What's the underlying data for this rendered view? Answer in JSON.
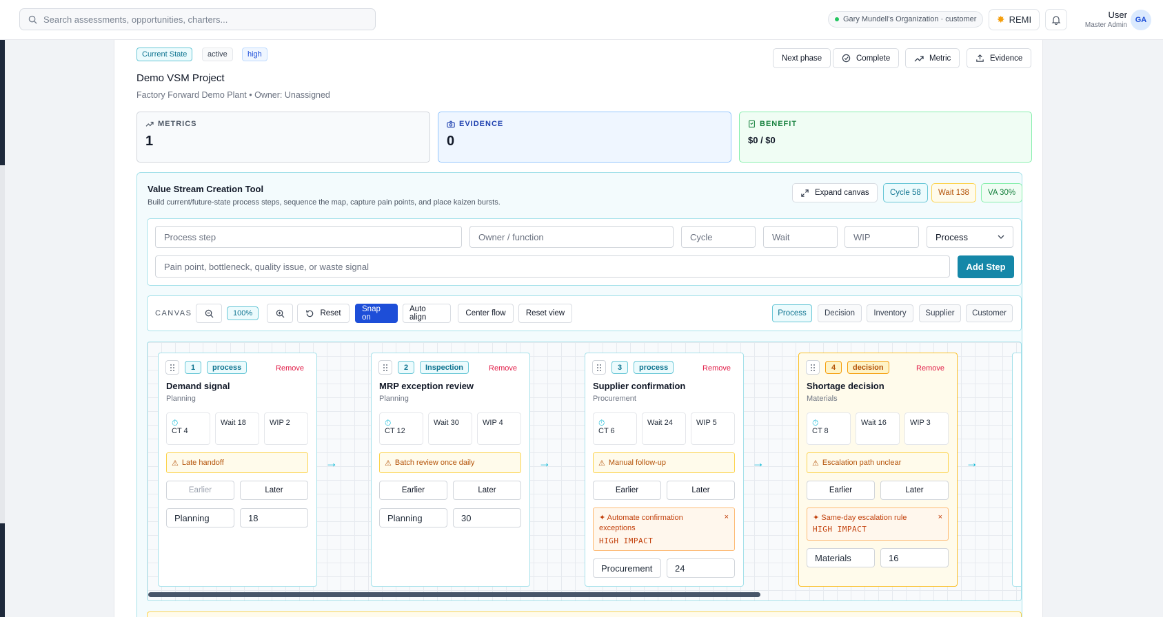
{
  "topbar": {
    "search_placeholder": "Search assessments, opportunities, charters...",
    "org": "Gary Mundell's Organization · customer",
    "remi": "REMI",
    "user_name": "User",
    "user_role": "Master Admin",
    "avatar": "GA"
  },
  "project": {
    "chips": [
      "Current State",
      "active",
      "high"
    ],
    "actions": [
      "Next phase",
      "Complete",
      "Metric",
      "Evidence"
    ],
    "title": "Demo VSM Project",
    "subtitle": "Factory Forward Demo Plant • Owner: Unassigned"
  },
  "cards": {
    "metrics_label": "METRICS",
    "metrics_value": "1",
    "evidence_label": "EVIDENCE",
    "evidence_value": "0",
    "benefit_label": "BENEFIT",
    "benefit_value": "$0 / $0"
  },
  "tool": {
    "title": "Value Stream Creation Tool",
    "desc": "Build current/future-state process steps, sequence the map, capture pain points, and place kaizen bursts.",
    "expand": "Expand canvas",
    "cycle": "Cycle 58",
    "wait": "Wait 138",
    "va": "VA 30%"
  },
  "form": {
    "step_ph": "Process step",
    "owner_ph": "Owner / function",
    "cycle_ph": "Cycle",
    "wait_ph": "Wait",
    "wip_ph": "WIP",
    "type_value": "Process",
    "pain_ph": "Pain point, bottleneck, quality issue, or waste signal",
    "add": "Add Step"
  },
  "canvas": {
    "label": "CANVAS",
    "zoom": "100%",
    "reset": "Reset",
    "snap": "Snap on",
    "auto_align": "Auto align",
    "center": "Center flow",
    "reset_view": "Reset view",
    "types": [
      "Process",
      "Decision",
      "Inventory",
      "Supplier",
      "Customer"
    ]
  },
  "steps": [
    {
      "n": "1",
      "kind": "process",
      "name": "Demand signal",
      "func": "Planning",
      "ct": "CT 4",
      "wait": "Wait 18",
      "wip": "WIP 2",
      "pain": "Late handoff",
      "earlier": "Earlier",
      "later": "Later",
      "owner": "Planning",
      "waitval": "18",
      "kaizen": "",
      "impact": ""
    },
    {
      "n": "2",
      "kind": "Inspection",
      "name": "MRP exception review",
      "func": "Planning",
      "ct": "CT 12",
      "wait": "Wait 30",
      "wip": "WIP 4",
      "pain": "Batch review once daily",
      "earlier": "Earlier",
      "later": "Later",
      "owner": "Planning",
      "waitval": "30",
      "kaizen": "",
      "impact": ""
    },
    {
      "n": "3",
      "kind": "process",
      "name": "Supplier confirmation",
      "func": "Procurement",
      "ct": "CT 6",
      "wait": "Wait 24",
      "wip": "WIP 5",
      "pain": "Manual follow-up",
      "earlier": "Earlier",
      "later": "Later",
      "owner": "Procurement",
      "waitval": "24",
      "kaizen": "✦ Automate confirmation exceptions",
      "impact": "HIGH IMPACT"
    },
    {
      "n": "4",
      "kind": "decision",
      "name": "Shortage decision",
      "func": "Materials",
      "ct": "CT 8",
      "wait": "Wait 16",
      "wip": "WIP 3",
      "pain": "Escalation path unclear",
      "earlier": "Earlier",
      "later": "Later",
      "owner": "Materials",
      "waitval": "16",
      "kaizen": "✦ Same-day escalation rule",
      "impact": "HIGH IMPACT"
    }
  ],
  "remove_label": "Remove"
}
